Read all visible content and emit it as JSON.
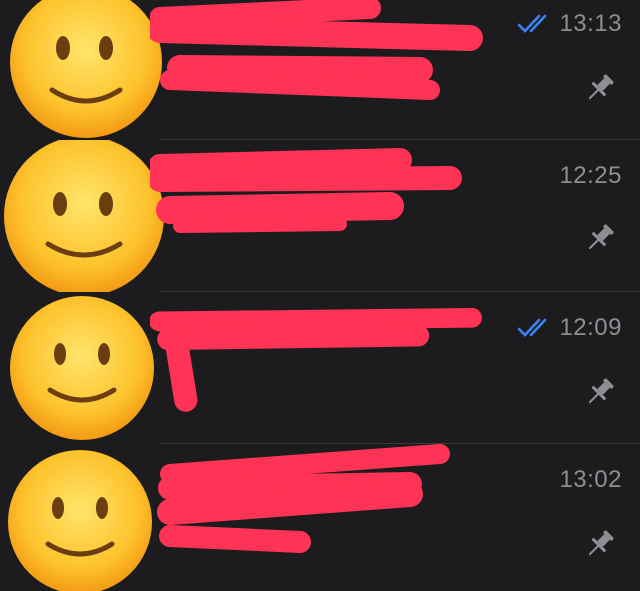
{
  "chats": [
    {
      "time": "13:13",
      "read_ticks": true,
      "pinned": true,
      "avatar_icon": "slightly-smiling-face-icon",
      "redacted": true
    },
    {
      "time": "12:25",
      "read_ticks": false,
      "pinned": true,
      "avatar_icon": "slightly-smiling-face-icon",
      "redacted": true
    },
    {
      "time": "12:09",
      "read_ticks": true,
      "pinned": true,
      "avatar_icon": "slightly-smiling-face-icon",
      "redacted": true
    },
    {
      "time": "13:02",
      "read_ticks": false,
      "pinned": true,
      "avatar_icon": "slightly-smiling-face-icon",
      "redacted": true
    }
  ],
  "colors": {
    "background": "#1c1c1e",
    "divider": "#3a3a3c",
    "time_text": "#8e8e93",
    "read_ticks": "#3b82f6",
    "pin_icon": "#8e8e93",
    "redaction": "#ff3355"
  }
}
